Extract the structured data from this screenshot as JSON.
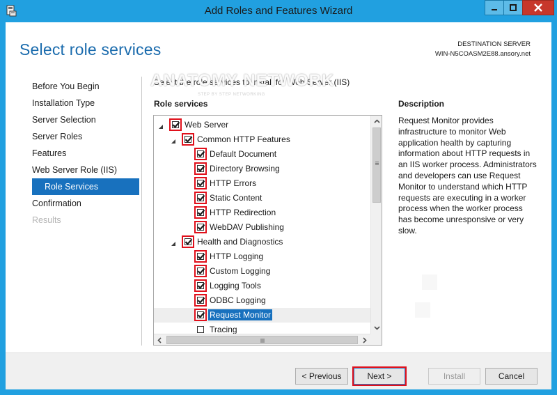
{
  "window": {
    "title": "Add Roles and Features Wizard",
    "accent": "#21a0e0",
    "close_color": "#c7372b"
  },
  "header": {
    "page_title": "Select role services",
    "destination_label": "DESTINATION SERVER",
    "destination_server": "WIN-N5COASM2E88.ansory.net"
  },
  "watermark": {
    "text": "ANATOMY NETWORK",
    "subtext": "STEP BY STEP NETWORKING"
  },
  "nav": {
    "items": [
      {
        "label": "Before You Begin",
        "state": "normal"
      },
      {
        "label": "Installation Type",
        "state": "normal"
      },
      {
        "label": "Server Selection",
        "state": "normal"
      },
      {
        "label": "Server Roles",
        "state": "normal"
      },
      {
        "label": "Features",
        "state": "normal"
      },
      {
        "label": "Web Server Role (IIS)",
        "state": "normal"
      },
      {
        "label": "Role Services",
        "state": "active"
      },
      {
        "label": "Confirmation",
        "state": "normal"
      },
      {
        "label": "Results",
        "state": "disabled"
      }
    ]
  },
  "main": {
    "instruction": "Select the role services to install for Web Server (IIS)",
    "role_services_label": "Role services",
    "tree": [
      {
        "label": "Web Server",
        "level": 0,
        "expander": "open",
        "checked": true
      },
      {
        "label": "Common HTTP Features",
        "level": 1,
        "expander": "open",
        "checked": true
      },
      {
        "label": "Default Document",
        "level": 2,
        "checked": true
      },
      {
        "label": "Directory Browsing",
        "level": 2,
        "checked": true
      },
      {
        "label": "HTTP Errors",
        "level": 2,
        "checked": true
      },
      {
        "label": "Static Content",
        "level": 2,
        "checked": true
      },
      {
        "label": "HTTP Redirection",
        "level": 2,
        "checked": true
      },
      {
        "label": "WebDAV Publishing",
        "level": 2,
        "checked": true
      },
      {
        "label": "Health and Diagnostics",
        "level": 1,
        "expander": "open",
        "checked": true
      },
      {
        "label": "HTTP Logging",
        "level": 2,
        "checked": true
      },
      {
        "label": "Custom Logging",
        "level": 2,
        "checked": true
      },
      {
        "label": "Logging Tools",
        "level": 2,
        "checked": true
      },
      {
        "label": "ODBC Logging",
        "level": 2,
        "checked": true
      },
      {
        "label": "Request Monitor",
        "level": 2,
        "checked": true,
        "selected": true
      },
      {
        "label": "Tracing",
        "level": 2,
        "checked": false,
        "partial": true
      }
    ]
  },
  "description": {
    "label": "Description",
    "text": "Request Monitor provides infrastructure to monitor Web application health by capturing information about HTTP requests in an IIS worker process. Administrators and developers can use Request Monitor to understand which HTTP requests are executing in a worker process when the worker process has become unresponsive or very slow."
  },
  "footer": {
    "previous_label": "< Previous",
    "next_label": "Next >",
    "install_label": "Install",
    "cancel_label": "Cancel"
  }
}
